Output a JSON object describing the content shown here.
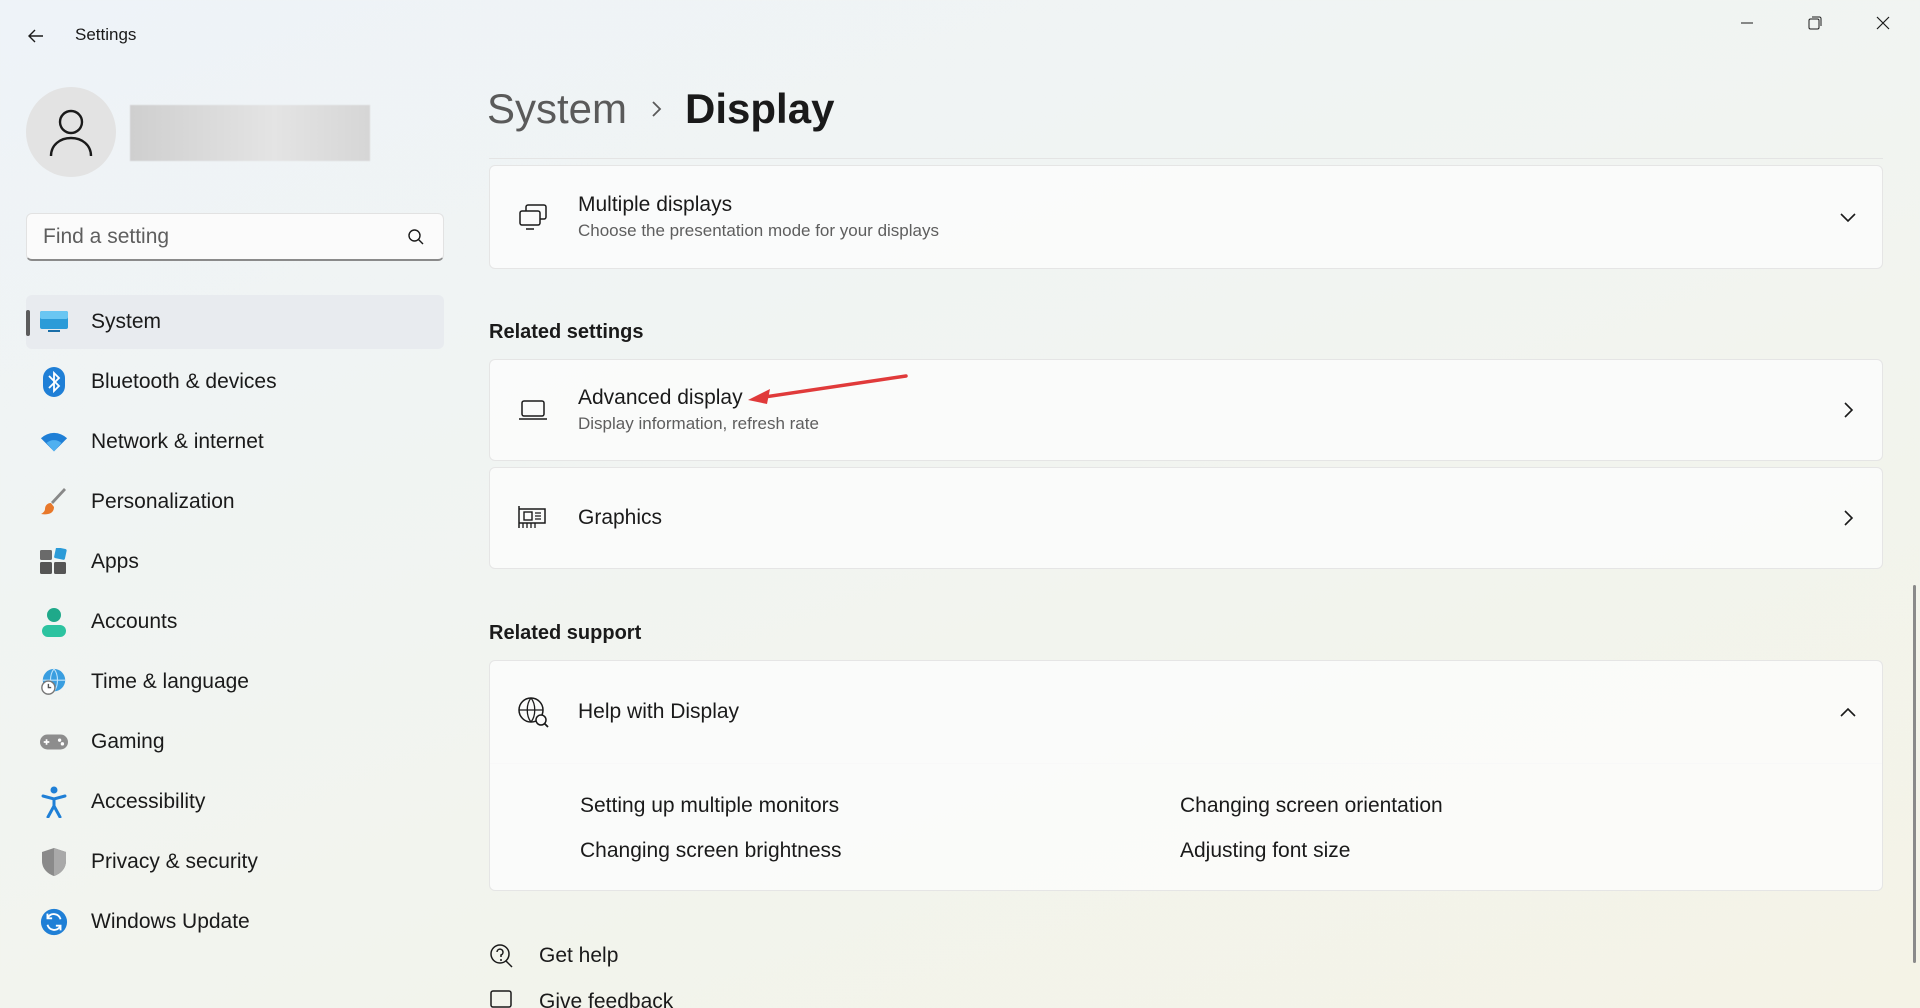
{
  "window": {
    "title": "Settings",
    "controls": {
      "minimize": "minimize-icon",
      "maximize": "restore-icon",
      "close": "close-icon"
    }
  },
  "sidebar": {
    "search": {
      "placeholder": "Find a setting",
      "value": ""
    },
    "items": [
      {
        "label": "System",
        "icon": "system-icon",
        "active": true
      },
      {
        "label": "Bluetooth & devices",
        "icon": "bluetooth-icon"
      },
      {
        "label": "Network & internet",
        "icon": "wifi-icon"
      },
      {
        "label": "Personalization",
        "icon": "brush-icon"
      },
      {
        "label": "Apps",
        "icon": "apps-icon"
      },
      {
        "label": "Accounts",
        "icon": "accounts-icon"
      },
      {
        "label": "Time & language",
        "icon": "globe-clock-icon"
      },
      {
        "label": "Gaming",
        "icon": "gamepad-icon"
      },
      {
        "label": "Accessibility",
        "icon": "accessibility-icon"
      },
      {
        "label": "Privacy & security",
        "icon": "shield-icon"
      },
      {
        "label": "Windows Update",
        "icon": "update-icon"
      }
    ]
  },
  "breadcrumb": {
    "parent": "System",
    "current": "Display"
  },
  "cards": {
    "multiple_displays": {
      "title": "Multiple displays",
      "subtitle": "Choose the presentation mode for your displays"
    },
    "advanced_display": {
      "title": "Advanced display",
      "subtitle": "Display information, refresh rate"
    },
    "graphics": {
      "title": "Graphics"
    }
  },
  "sections": {
    "related_settings": "Related settings",
    "related_support": "Related support"
  },
  "help": {
    "title": "Help with Display",
    "links": [
      "Setting up multiple monitors",
      "Changing screen orientation",
      "Changing screen brightness",
      "Adjusting font size"
    ]
  },
  "footer": {
    "get_help": "Get help",
    "give_feedback": "Give feedback"
  },
  "colors": {
    "accent": "#0067c0",
    "annotation_arrow": "#e03a3a"
  }
}
